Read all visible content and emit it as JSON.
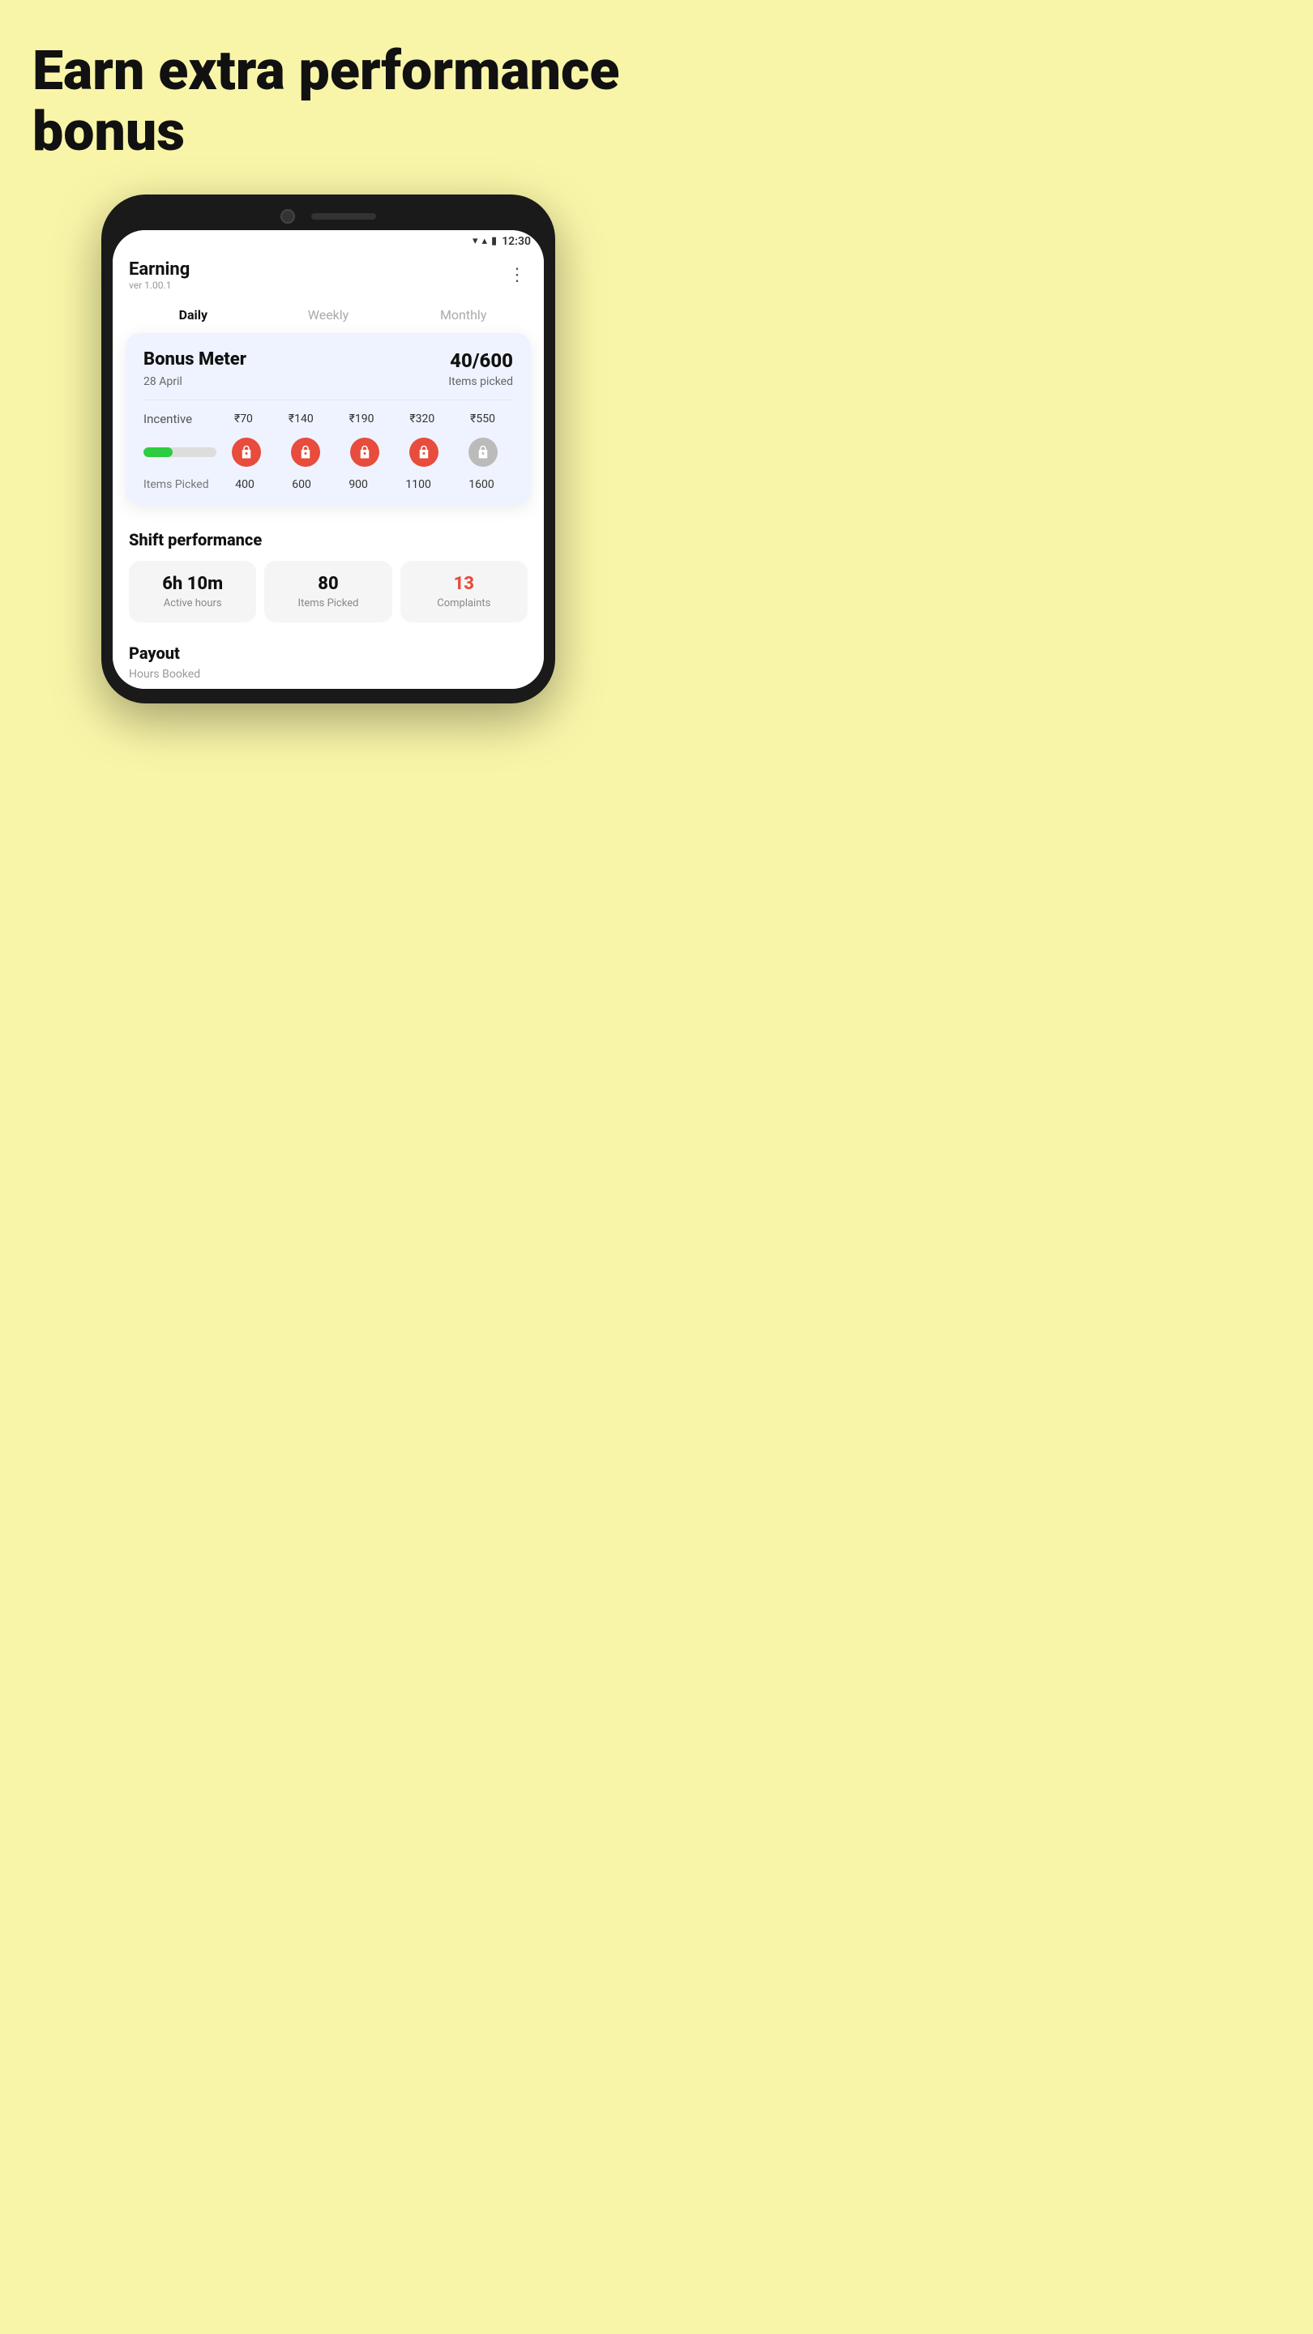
{
  "hero": {
    "headline": "Earn extra performance bonus"
  },
  "status_bar": {
    "time": "12:30",
    "wifi": "▼",
    "signal": "▲",
    "battery": "🔋"
  },
  "app_header": {
    "title": "Earning",
    "version": "ver 1.00.1",
    "menu_icon": "⋮"
  },
  "tabs": [
    {
      "label": "Daily",
      "active": true
    },
    {
      "label": "Weekly",
      "active": false
    },
    {
      "label": "Monthly",
      "active": false
    }
  ],
  "bonus_meter": {
    "title": "Bonus Meter",
    "count": "40/600",
    "date": "28 April",
    "items_label": "Items picked",
    "incentive_label": "Incentive",
    "incentive_values": [
      "₹70",
      "₹140",
      "₹190",
      "₹320",
      "₹550"
    ],
    "progress_percent": 40,
    "items_picked_label": "Items Picked",
    "items_picked_values": [
      "400",
      "600",
      "900",
      "1100",
      "1600"
    ]
  },
  "shift_performance": {
    "title": "Shift performance",
    "cards": [
      {
        "value": "6h 10m",
        "label": "Active hours",
        "red": false
      },
      {
        "value": "80",
        "label": "Items Picked",
        "red": false
      },
      {
        "value": "13",
        "label": "Complaints",
        "red": true
      }
    ]
  },
  "payout": {
    "title": "Payout",
    "subtitle": "Hours Booked"
  }
}
